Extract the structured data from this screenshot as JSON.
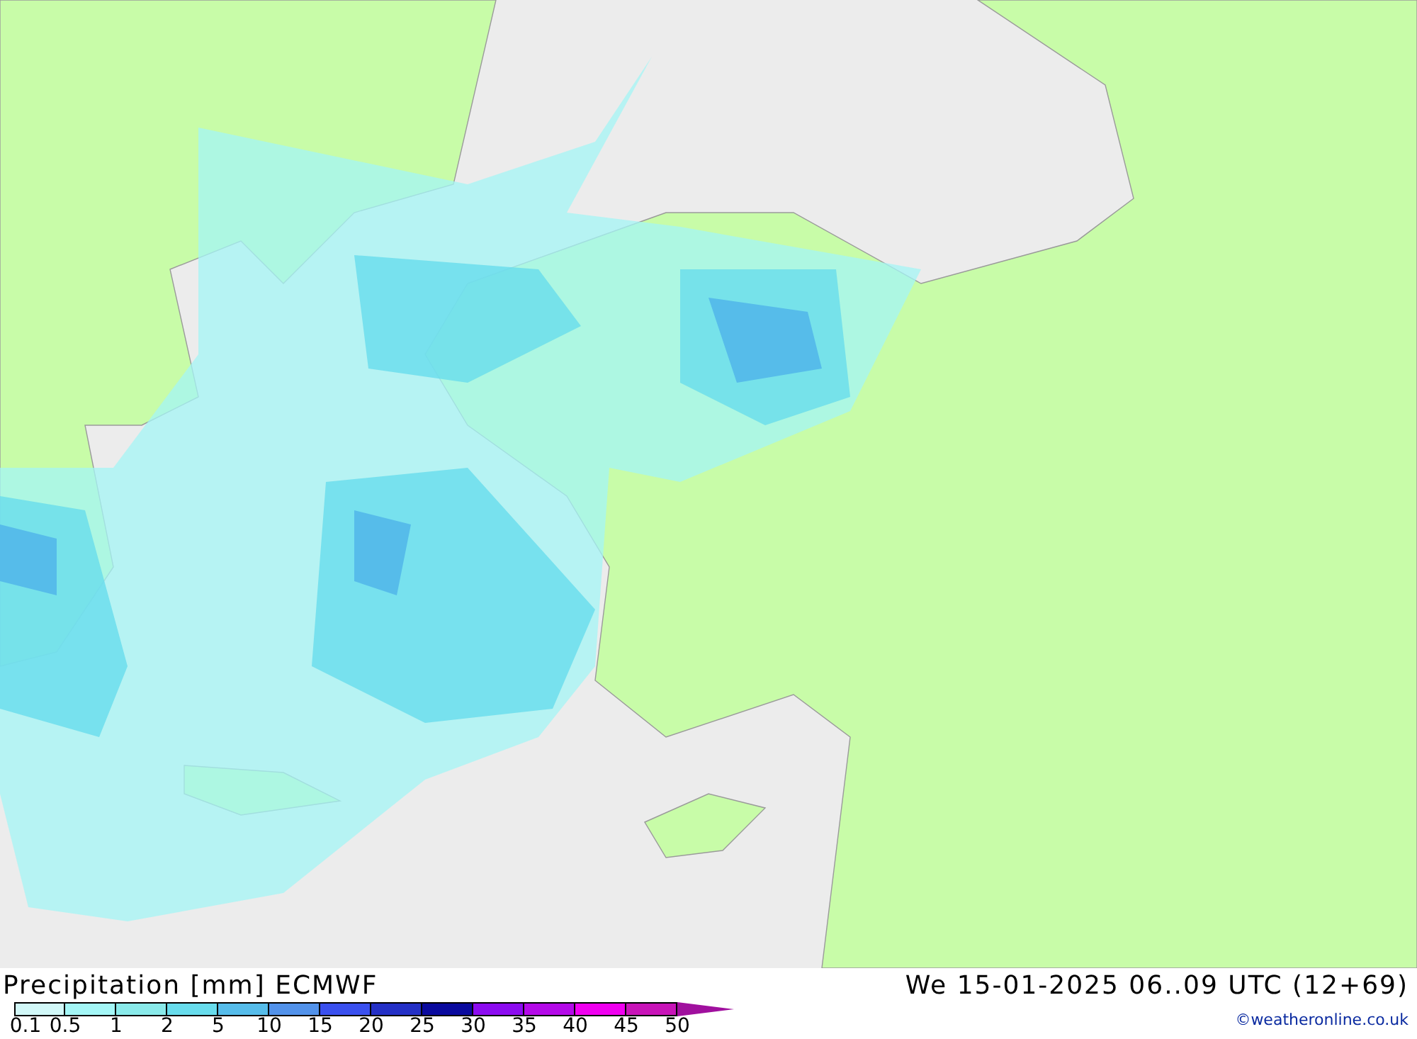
{
  "title": "Precipitation [mm] ECMWF",
  "valid_time": "We 15-01-2025 06..09 UTC (12+69)",
  "credit": "©weatheronline.co.uk",
  "legend": {
    "bins": [
      {
        "label": "0.1",
        "color": "#d2f8f8"
      },
      {
        "label": "0.5",
        "color": "#a4f6f6"
      },
      {
        "label": "1",
        "color": "#8aeaea"
      },
      {
        "label": "2",
        "color": "#68dcec"
      },
      {
        "label": "5",
        "color": "#56bcea"
      },
      {
        "label": "10",
        "color": "#5292ea"
      },
      {
        "label": "15",
        "color": "#3a50ee"
      },
      {
        "label": "20",
        "color": "#2430c6"
      },
      {
        "label": "25",
        "color": "#0a0a9e"
      },
      {
        "label": "30",
        "color": "#8c0cf0"
      },
      {
        "label": "35",
        "color": "#b40ae8"
      },
      {
        "label": "40",
        "color": "#f000f0"
      },
      {
        "label": "45",
        "color": "#c814b8"
      }
    ],
    "end_label": "50"
  }
}
